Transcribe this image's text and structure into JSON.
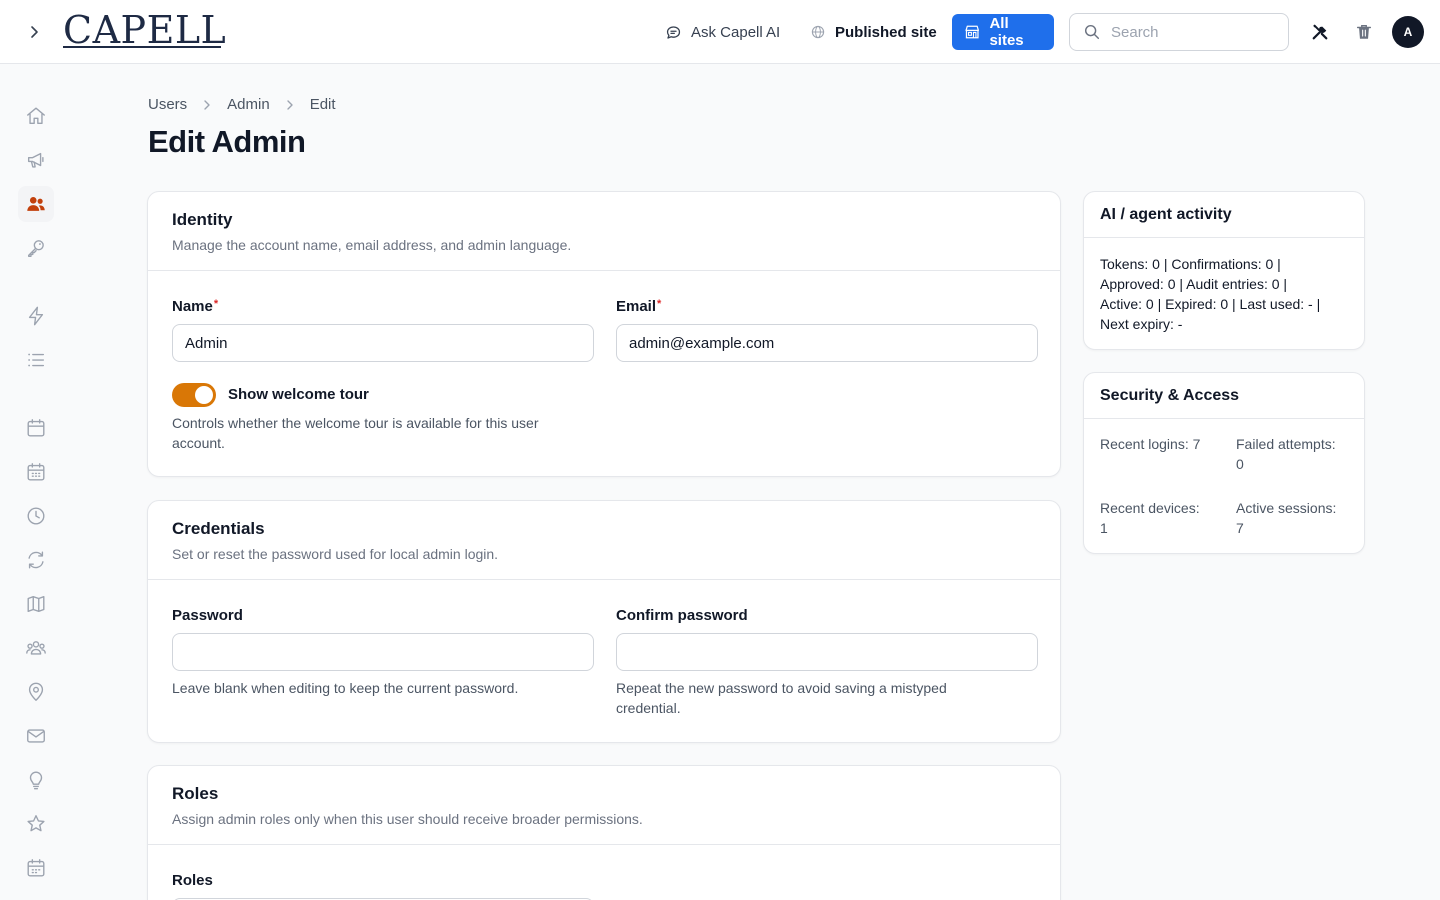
{
  "header": {
    "logo_text": "CAPELL",
    "ask_ai_label": "Ask Capell AI",
    "published_site_label": "Published site",
    "all_sites_label": "All sites",
    "search_placeholder": "Search",
    "avatar_initial": "A",
    "accent_color": "#1f6feb"
  },
  "sidebar": {
    "items": [
      {
        "icon": "home-icon"
      },
      {
        "icon": "megaphone-icon"
      },
      {
        "icon": "users-icon",
        "active": true
      },
      {
        "icon": "key-icon"
      },
      {
        "icon": "bolt-icon"
      },
      {
        "icon": "list-icon"
      },
      {
        "icon": "calendar-icon"
      },
      {
        "icon": "calendar-grid-icon"
      },
      {
        "icon": "clock-icon"
      },
      {
        "icon": "refresh-icon"
      },
      {
        "icon": "map-icon"
      },
      {
        "icon": "user-group-icon"
      },
      {
        "icon": "map-pin-icon"
      },
      {
        "icon": "envelope-icon"
      },
      {
        "icon": "lightbulb-icon"
      },
      {
        "icon": "star-icon"
      },
      {
        "icon": "calendar-days-icon"
      }
    ],
    "active_color": "#c2410c"
  },
  "breadcrumb": {
    "items": [
      "Users",
      "Admin",
      "Edit"
    ]
  },
  "page": {
    "title": "Edit Admin"
  },
  "identity": {
    "title": "Identity",
    "description": "Manage the account name, email address, and admin language.",
    "name_label": "Name",
    "name_value": "Admin",
    "email_label": "Email",
    "email_value": "admin@example.com",
    "required_mark": "*",
    "toggle_label": "Show welcome tour",
    "toggle_on": true,
    "toggle_help_line1": "Controls whether the welcome tour is available for this user",
    "toggle_help_line2": "account.",
    "toggle_color": "#d97706"
  },
  "credentials": {
    "title": "Credentials",
    "description": "Set or reset the password used for local admin login.",
    "password_label": "Password",
    "password_value": "",
    "password_help": "Leave blank when editing to keep the current password.",
    "confirm_label": "Confirm password",
    "confirm_value": "",
    "confirm_help_line1": "Repeat the new password to avoid saving a mistyped",
    "confirm_help_line2": "credential."
  },
  "roles": {
    "title": "Roles",
    "description": "Assign admin roles only when this user should receive broader permissions.",
    "roles_label": "Roles"
  },
  "ai_activity": {
    "title": "AI / agent activity",
    "line1": "Tokens: 0 | Confirmations: 0 |",
    "line2": "Approved: 0 | Audit entries: 0 |",
    "line3": "Active: 0 | Expired: 0 | Last used: - |",
    "line4": "Next expiry: -"
  },
  "security": {
    "title": "Security & Access",
    "recent_logins_label": "Recent logins:",
    "recent_logins_value": "7",
    "failed_attempts_label": "Failed attempts:",
    "failed_attempts_value": "0",
    "recent_devices_label": "Recent devices:",
    "recent_devices_value": "1",
    "active_sessions_label": "Active sessions:",
    "active_sessions_value": "7"
  }
}
